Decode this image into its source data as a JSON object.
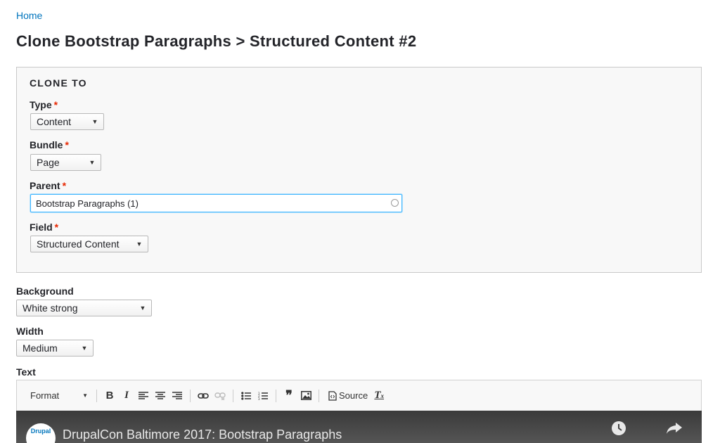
{
  "breadcrumb": {
    "home": "Home"
  },
  "page": {
    "title": "Clone Bootstrap Paragraphs > Structured Content #2"
  },
  "clone_to": {
    "legend": "CLONE TO",
    "type": {
      "label": "Type",
      "required": "*",
      "value": "Content"
    },
    "bundle": {
      "label": "Bundle",
      "required": "*",
      "value": "Page"
    },
    "parent": {
      "label": "Parent",
      "required": "*",
      "value": "Bootstrap Paragraphs (1)"
    },
    "field": {
      "label": "Field",
      "required": "*",
      "value": "Structured Content"
    }
  },
  "background": {
    "label": "Background",
    "value": "White strong"
  },
  "width": {
    "label": "Width",
    "value": "Medium"
  },
  "text": {
    "label": "Text"
  },
  "editor": {
    "format_label": "Format",
    "source_label": "Source",
    "icons": [
      "bold-icon",
      "italic-icon",
      "align-left-icon",
      "align-center-icon",
      "align-right-icon",
      "link-icon",
      "unlink-icon",
      "bulleted-list-icon",
      "numbered-list-icon",
      "blockquote-icon",
      "image-icon",
      "source-icon",
      "remove-format-icon"
    ]
  },
  "video": {
    "title": "DrupalCon Baltimore 2017: Bootstrap Paragraphs",
    "logo_text": "Drupal"
  },
  "colors": {
    "link": "#0074bd",
    "required": "#e62600",
    "focus": "#40b6ff"
  }
}
